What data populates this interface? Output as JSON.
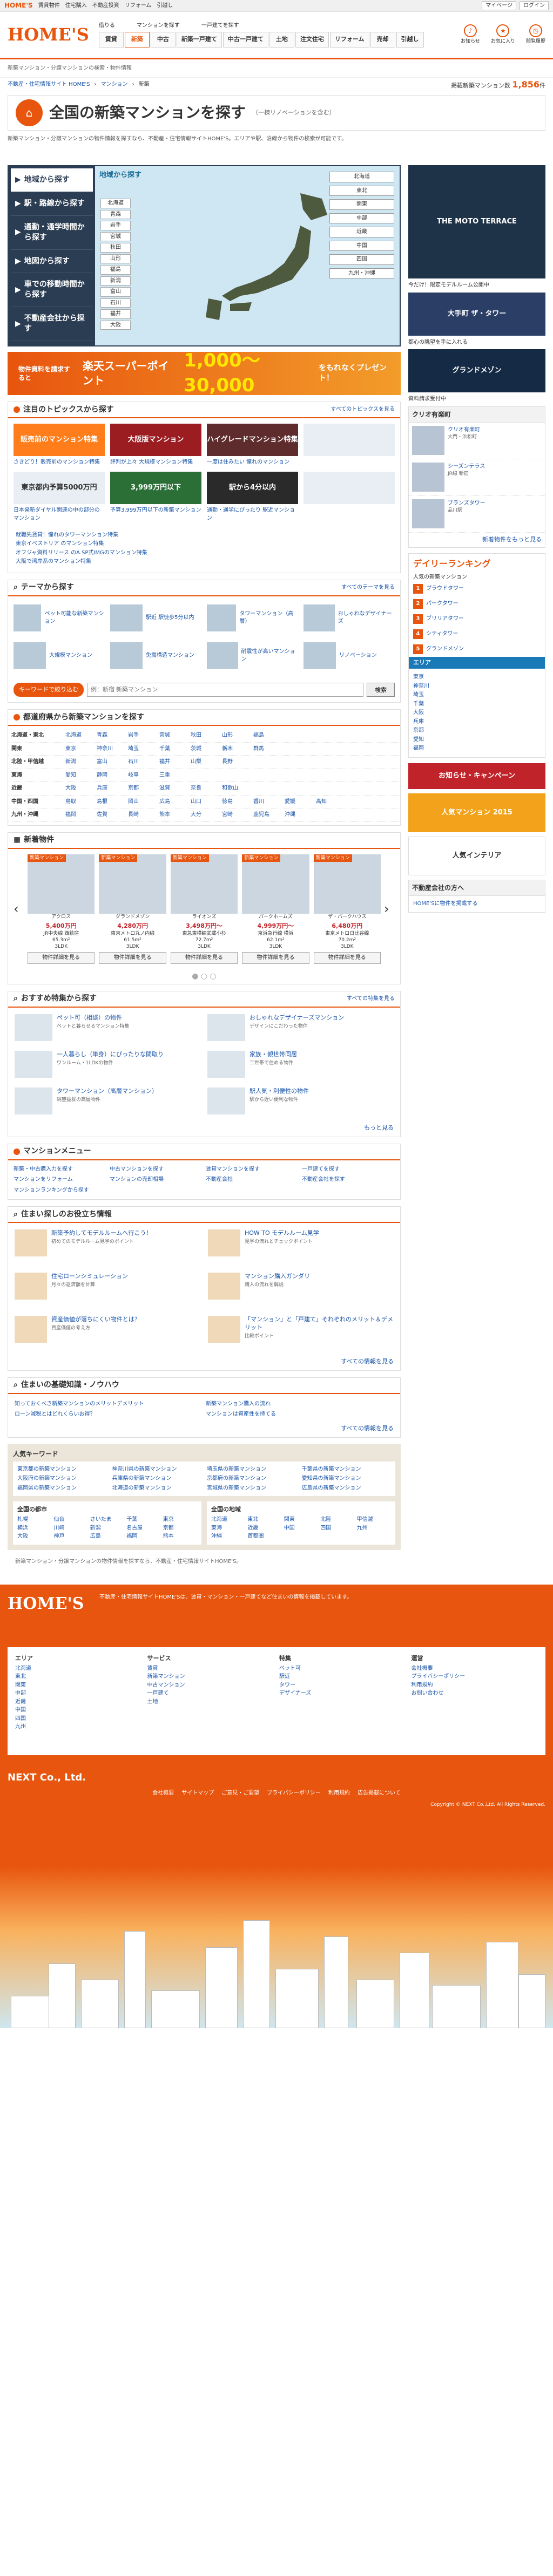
{
  "topbar": {
    "site": "HOME'S",
    "links": [
      "賃貸物件",
      "住宅購入",
      "不動産投資",
      "リフォーム",
      "引越し"
    ],
    "right": [
      "マイページ",
      "ログイン"
    ]
  },
  "header": {
    "logo": "HOME'S",
    "label_buy": "借りる",
    "label_search": "マンションを探す",
    "label_sell": "一戸建てを探す",
    "tabs": [
      "賃貸",
      "新築",
      "中古",
      "新築一戸建て",
      "中古一戸建て",
      "土地",
      "注文住宅",
      "リフォーム",
      "売却",
      "引越し"
    ],
    "icons": [
      {
        "icon": "bell-icon",
        "label": "お知らせ"
      },
      {
        "icon": "star-icon",
        "label": "お気に入り"
      },
      {
        "icon": "clock-icon",
        "label": "閲覧履歴"
      }
    ]
  },
  "crumb_top": "新築マンション・分譲マンションの検索・物件情報",
  "breadcrumb": {
    "items": [
      "不動産・住宅情報サイト HOME'S",
      "マンション",
      "新築"
    ],
    "count_label": "掲載新築マンション数",
    "count": "1,856",
    "unit": "件"
  },
  "title": {
    "heading": "全国の新築マンションを探す",
    "sub": "（一棟リノベーションを含む）"
  },
  "intro": "新築マンション・分譲マンションの物件情報を探すなら、不動産・住宅情報サイトHOME'S。エリアや駅、沿線から物件の検索が可能です。",
  "search_tabs": [
    "地域から探す",
    "駅・路線から探す",
    "通勤・通学時間から探す",
    "地図から探す",
    "車での移動時間から探す",
    "不動産会社から探す"
  ],
  "map": {
    "heading": "地域から探す",
    "left_prefs": [
      "北海道",
      "青森",
      "岩手",
      "宮城",
      "秋田",
      "山形",
      "福島",
      "新潟",
      "富山",
      "石川",
      "福井",
      "大阪"
    ],
    "regions": [
      "北海道",
      "東北",
      "関東",
      "中部",
      "近畿",
      "中国",
      "四国",
      "九州・沖縄"
    ]
  },
  "rakuten": {
    "pre": "物件資料を請求すると",
    "brand": "楽天スーパーポイント",
    "amount": "1,000〜30,000",
    "post": "をもれなくプレゼント！"
  },
  "topics": {
    "title": "注目のトピックスから探す",
    "more": "すべてのトピックスを見る",
    "items": [
      {
        "img": "販売前のマンション特集",
        "label": "さきどり！販売前のマンション特集"
      },
      {
        "img": "大阪版マンション",
        "label": "評判が上々 大規模マンション特集"
      },
      {
        "img": "ハイグレードマンション特集",
        "label": "一度は住みたい 憧れのマンション"
      },
      {
        "img": "",
        "label": ""
      },
      {
        "img": "東京都内予算5000万円",
        "label": "日本発新ダイヤル関連の中の部分のマンション"
      },
      {
        "img": "3,999万円以下",
        "label": "予算3,999万円以下の新築マンション"
      },
      {
        "img": "駅から4分以内",
        "label": "通勤・通学にぴったり 駅近マンション"
      },
      {
        "img": "",
        "label": ""
      }
    ],
    "links": [
      "就職先賃貸！憧れのタワーマンション特集",
      "東京イベストリア のマンション特集",
      "オフジャ資料リリース のA.SP式IMGのマンション特集",
      "大阪で湾岸系のマンション特集"
    ]
  },
  "themes": {
    "title": "テーマから探す",
    "more": "すべてのテーマを見る",
    "items": [
      "ペット可能な新築マンション",
      "駅近 駅徒歩5分以内",
      "タワーマンション（高層）",
      "おしゃれなデザイナーズ",
      "大規模マンション",
      "免震構造マンション",
      "耐震性が高いマンション",
      "リノベーション"
    ]
  },
  "keyword": {
    "label": "キーワードで絞り込む",
    "placeholder": "例：新宿 新築マンション",
    "button": "検索"
  },
  "areas": {
    "title": "都道府県から新築マンションを探す",
    "rows": [
      {
        "region": "北海道・東北",
        "prefs": [
          "北海道",
          "青森",
          "岩手",
          "宮城",
          "秋田",
          "山形",
          "福島"
        ]
      },
      {
        "region": "関東",
        "prefs": [
          "東京",
          "神奈川",
          "埼玉",
          "千葉",
          "茨城",
          "栃木",
          "群馬"
        ]
      },
      {
        "region": "北陸・甲信越",
        "prefs": [
          "新潟",
          "富山",
          "石川",
          "福井",
          "山梨",
          "長野"
        ]
      },
      {
        "region": "東海",
        "prefs": [
          "愛知",
          "静岡",
          "岐阜",
          "三重"
        ]
      },
      {
        "region": "近畿",
        "prefs": [
          "大阪",
          "兵庫",
          "京都",
          "滋賀",
          "奈良",
          "和歌山"
        ]
      },
      {
        "region": "中国・四国",
        "prefs": [
          "鳥取",
          "島根",
          "岡山",
          "広島",
          "山口",
          "徳島",
          "香川",
          "愛媛",
          "高知"
        ]
      },
      {
        "region": "九州・沖縄",
        "prefs": [
          "福岡",
          "佐賀",
          "長崎",
          "熊本",
          "大分",
          "宮崎",
          "鹿児島",
          "沖縄"
        ]
      }
    ]
  },
  "newprops": {
    "title": "新着物件",
    "items": [
      {
        "badge": "新築マンション",
        "name": "アクロス",
        "price": "5,400万円",
        "loc": "JR中央線 西荻窪",
        "size": "65.3m²",
        "layout": "3LDK",
        "btn": "物件詳細を見る"
      },
      {
        "badge": "新築マンション",
        "name": "グランドメゾン",
        "price": "4,280万円",
        "loc": "東京メトロ丸ノ内線",
        "size": "61.5m²",
        "layout": "3LDK",
        "btn": "物件詳細を見る"
      },
      {
        "badge": "新築マンション",
        "name": "ライオンズ",
        "price": "3,498万円〜",
        "loc": "東急東横線武蔵小杉",
        "size": "72.7m²",
        "layout": "3LDK",
        "btn": "物件詳細を見る"
      },
      {
        "badge": "新築マンション",
        "name": "パークホームズ",
        "price": "4,999万円〜",
        "loc": "京浜急行線 横浜",
        "size": "62.1m²",
        "layout": "3LDK",
        "btn": "物件詳細を見る"
      },
      {
        "badge": "新築マンション",
        "name": "ザ・パークハウス",
        "price": "6,480万円",
        "loc": "東京メトロ日比谷線",
        "size": "70.2m²",
        "layout": "3LDK",
        "btn": "物件詳細を見る"
      }
    ]
  },
  "features": {
    "title": "おすすめ特集から探す",
    "more": "すべての特集を見る",
    "items": [
      {
        "t": "ペット可（相談）の物件",
        "d": "ペットと暮らせるマンション特集"
      },
      {
        "t": "おしゃれなデザイナーズマンション",
        "d": "デザインにこだわった物件"
      },
      {
        "t": "一人暮らし（単身）にぴったりな間取り",
        "d": "ワンルーム・1LDKの物件"
      },
      {
        "t": "家族・親世帯同居",
        "d": "二世帯で住める物件"
      },
      {
        "t": "タワーマンション（高層マンション）",
        "d": "眺望抜群の高層物件"
      },
      {
        "t": "駅人気・利便性の物件",
        "d": "駅から近い便利な物件"
      }
    ],
    "more2": "もっと見る"
  },
  "menu": {
    "title": "マンションメニュー",
    "items": [
      "新築・中古購入力を探す",
      "中古マンションを探す",
      "賃貸マンションを探す",
      "一戸建てを探す",
      "マンションをリフォーム",
      "マンションの売却相場",
      "不動産会社",
      "不動産会社を探す",
      "マンションランキングから探す"
    ]
  },
  "useful": {
    "title": "住まい探しのお役立ち情報",
    "items": [
      {
        "t": "新築予約してモデルルームへ行こう！",
        "d": "初めてのモデルルーム見学のポイント"
      },
      {
        "t": "HOW TO モデルルーム見学",
        "d": "見学の流れとチェックポイント"
      },
      {
        "t": "住宅ローンシミュレーション",
        "d": "月々の返済額を計算"
      },
      {
        "t": "マンション購入ガンダリ",
        "d": "購入の流れを解説"
      },
      {
        "t": "資産価値が落ちにくい物件とは？",
        "d": "資産価値の考え方"
      },
      {
        "t": "「マンション」と「戸建て」それぞれのメリット＆デメリット",
        "d": "比較ポイント"
      }
    ],
    "more": "すべての情報を見る"
  },
  "basics": {
    "title": "住まいの基礎知識・ノウハウ",
    "items": [
      "知っておくべき新築マンションのメリットデメリット",
      "新築マンション購入の流れ",
      "ローン減税とはどれくらいお得？",
      "マンションは資産性を持てる"
    ],
    "more": "すべての情報を見る"
  },
  "keywords": {
    "title": "人気キーワード",
    "items": [
      "東京都の新築マンション",
      "神奈川県の新築マンション",
      "埼玉県の新築マンション",
      "千葉県の新築マンション",
      "大阪府の新築マンション",
      "兵庫県の新築マンション",
      "京都府の新築マンション",
      "愛知県の新築マンション",
      "福岡県の新築マンション",
      "北海道の新築マンション",
      "宮城県の新築マンション",
      "広島県の新築マンション"
    ]
  },
  "allregions": {
    "left_title": "全国の都市",
    "left": [
      "札幌",
      "仙台",
      "さいたま",
      "千葉",
      "東京",
      "横浜",
      "川崎",
      "新潟",
      "名古屋",
      "京都",
      "大阪",
      "神戸",
      "広島",
      "福岡",
      "熊本"
    ],
    "right_title": "全国の地域",
    "right": [
      "北海道",
      "東北",
      "関東",
      "北陸",
      "甲信越",
      "東海",
      "近畿",
      "中国",
      "四国",
      "九州",
      "沖縄",
      "首都圏"
    ]
  },
  "note": "新築マンション・分譲マンションの物件情報を探すなら、不動産・住宅情報サイトHOME'S。",
  "side": {
    "banner1": "THE MOTO TERRACE",
    "banner1_cap": "今だけ！限定モデルルーム公開中",
    "banner2": "大手町 ザ・タワー",
    "banner2_cap": "都心の眺望を手に入れる",
    "banner3": "グランドメゾン",
    "banner3_cap": "資料請求受付中",
    "box_title": "クリオ有楽町",
    "box_items": [
      {
        "t": "クリオ有楽町",
        "d": "大門・浜松町"
      },
      {
        "t": "シーズンテラス",
        "d": "JR線 新宿"
      },
      {
        "t": "ブランズタワー",
        "d": "品川駅"
      }
    ],
    "box_more": "新着物件をもっと見る",
    "ranking_title": "デイリーランキング",
    "ranking_sub": "人気の新築マンション",
    "ranking": [
      "プラウドタワー",
      "パークタワー",
      "ブリリアタワー",
      "シティタワー",
      "グランドメゾン"
    ],
    "area_title": "エリア",
    "area_list": [
      "東京",
      "神奈川",
      "埼玉",
      "千葉",
      "大阪",
      "兵庫",
      "京都",
      "愛知",
      "福岡"
    ],
    "btn1": "お知らせ・キャンペーン",
    "btn2": "人気マンション 2015",
    "btn3": "人気インテリア",
    "sec2_title": "不動産会社の方へ",
    "sec2_text": "HOME'Sに物件を掲載する"
  },
  "footer": {
    "logo": "HOME'S",
    "text": "不動産・住宅情報サイトHOME'Sは、賃貸・マンション・一戸建てなど住まいの情報を掲載しています。",
    "col1_title": "エリア",
    "col1": [
      "北海道",
      "東北",
      "関東",
      "中部",
      "近畿",
      "中国",
      "四国",
      "九州"
    ],
    "col2_title": "サービス",
    "col2": [
      "賃貸",
      "新築マンション",
      "中古マンション",
      "一戸建て",
      "土地"
    ],
    "col3_title": "特集",
    "col3": [
      "ペット可",
      "駅近",
      "タワー",
      "デザイナーズ"
    ],
    "col4_title": "運営",
    "col4": [
      "会社概要",
      "プライバシーポリシー",
      "利用規約",
      "お問い合わせ"
    ]
  },
  "next": {
    "logo": "NEXT Co., Ltd.",
    "nav": [
      "会社概要",
      "サイトマップ",
      "ご意見・ご要望",
      "プライバシーポリシー",
      "利用規約",
      "広告掲載について"
    ],
    "copy": "Copyright © NEXT Co.,Ltd. All Rights Reserved."
  },
  "colors": {
    "accent": "#e8550e",
    "navy": "#2b3d53",
    "map": "#cfe7f3"
  }
}
